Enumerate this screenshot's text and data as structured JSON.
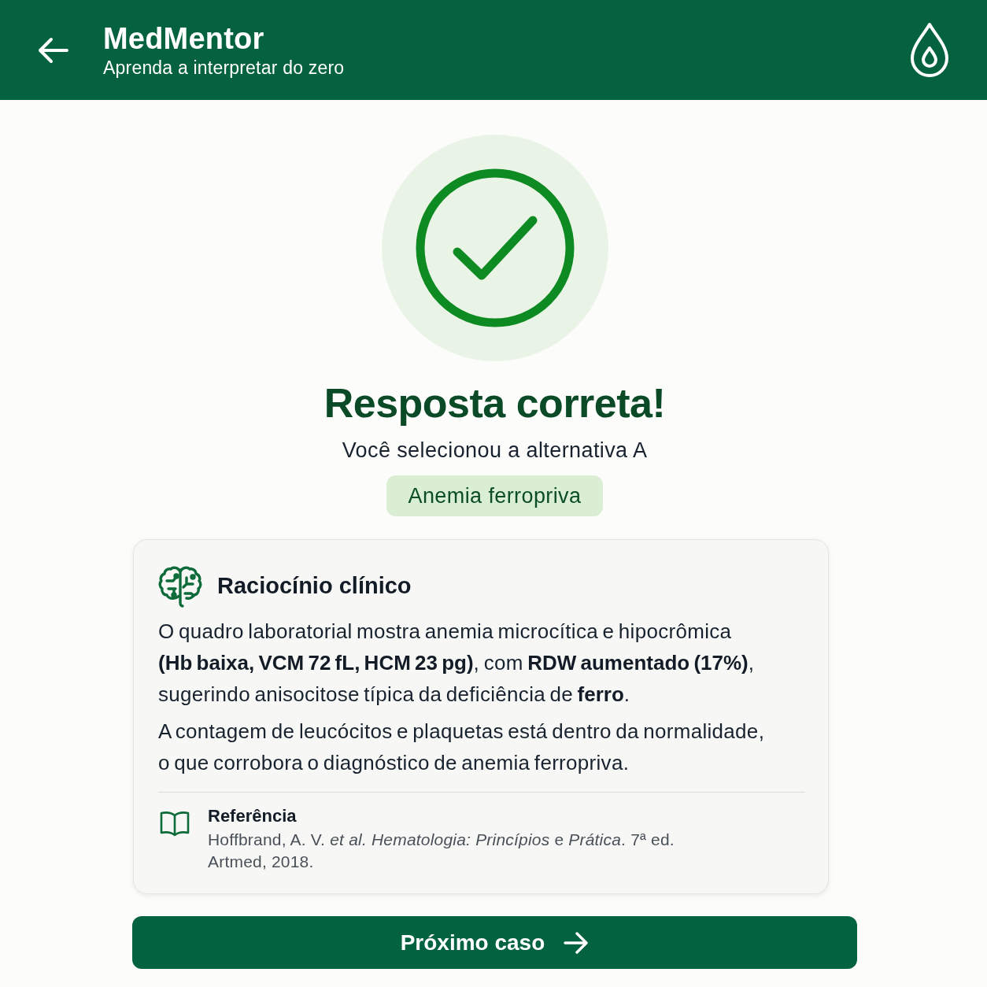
{
  "header": {
    "title": "MedMentor",
    "subtitle": "Aprenda a interpretar do zero"
  },
  "result": {
    "kind": "correct",
    "title": "Resposta correta!",
    "message": "Você selecionou a alternativa A",
    "answer": "Anemia ferropriva"
  },
  "explanation": {
    "title": "Raciocínio clínico",
    "paragraphs": [
      "O quadro laboratorial mostra anemia microcítica e hipocrômica **(Hb baixa, VCM 72 fL, HCM 23 pg)**, com **RDW aumentado (17%)**, sugerindo anisocitose típica da deficiência de **ferro**.",
      "A contagem de leucócitos e plaquetas está dentro da normalidade, o que corrobora o diagnóstico de anemia ferropriva."
    ],
    "reference": {
      "title": "Referência",
      "citation": "Hoffbrand, A. V. *et al.* *Hematologia: Princípios* e *Prática*. 7ª ed. Artmed, 2018."
    }
  },
  "next_button": {
    "label": "Próximo caso"
  }
}
